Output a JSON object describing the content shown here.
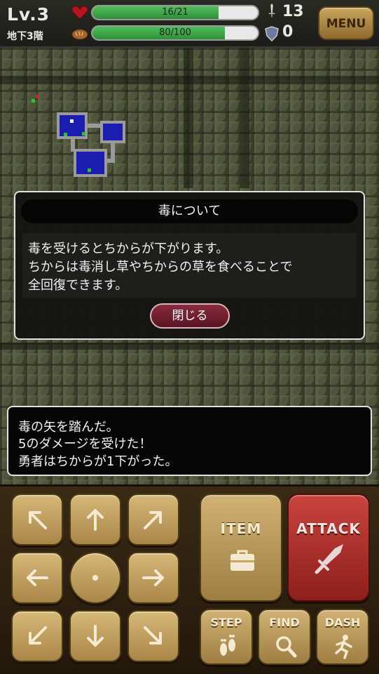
{
  "hud": {
    "level": "Lv.3",
    "floor": "地下3階",
    "hp_text": "16/21",
    "hp_fraction": 0.762,
    "food_text": "80/100",
    "food_fraction": 0.8,
    "attack_value": "13",
    "defense_value": "0",
    "menu_label": "MENU",
    "icons": {
      "hp": "heart-icon",
      "food": "bread-icon",
      "attack": "sword-icon",
      "defense": "shield-icon"
    }
  },
  "dialog": {
    "title": "毒について",
    "lines": [
      "毒を受けるとちからが下がります。",
      "ちからは毒消し草やちからの草を食べることで",
      "全回復できます。"
    ],
    "close_label": "閉じる"
  },
  "log": {
    "lines": [
      "毒の矢を踏んだ。",
      "5のダメージを受けた！",
      "勇者はちからが1下がった。"
    ]
  },
  "controls": {
    "item_label": "ITEM",
    "attack_label": "ATTACK",
    "step_label": "STEP",
    "find_label": "FIND",
    "dash_label": "DASH",
    "dpad": [
      "arrow-up-left-icon",
      "arrow-up-icon",
      "arrow-up-right-icon",
      "arrow-left-icon",
      "wait-dot-icon",
      "arrow-right-icon",
      "arrow-down-left-icon",
      "arrow-down-icon",
      "arrow-down-right-icon"
    ]
  },
  "colors": {
    "hp_fill": "#3fae4a",
    "attack_button": "#b8332e",
    "minimap_room": "#1b1db0"
  }
}
